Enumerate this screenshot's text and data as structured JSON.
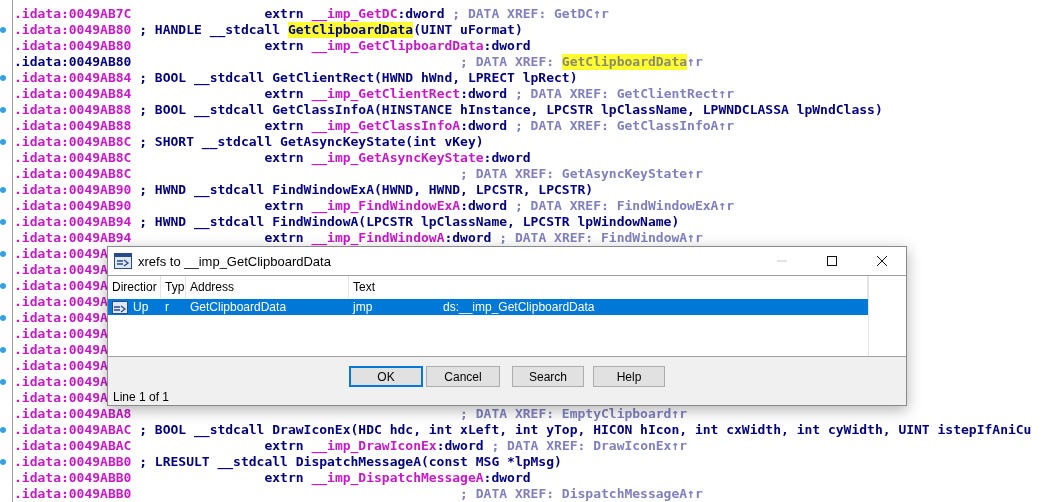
{
  "listing": {
    "rows": [
      {
        "address": ".idata:0049AB7C",
        "kind": "extrn",
        "current": false,
        "segments": [
          {
            "kind": "code",
            "text": "extrn "
          },
          {
            "kind": "name",
            "text": "__imp_GetDC"
          },
          {
            "kind": "code",
            "text": ":dword "
          },
          {
            "kind": "comment",
            "text": "; DATA XREF: GetDC↑r"
          }
        ]
      },
      {
        "address": ".idata:0049AB80",
        "kind": "decl",
        "current": false,
        "segments": [
          {
            "kind": "code",
            "text": "; HANDLE __stdcall "
          },
          {
            "kind": "code_match",
            "text": "GetClipboardData"
          },
          {
            "kind": "code",
            "text": "(UINT uFormat)"
          }
        ]
      },
      {
        "address": ".idata:0049AB80",
        "kind": "extrn",
        "current": false,
        "segments": [
          {
            "kind": "code",
            "text": "extrn "
          },
          {
            "kind": "name",
            "text": "__imp_GetClipboardData"
          },
          {
            "kind": "code",
            "text": ":dword"
          }
        ]
      },
      {
        "address": ".idata:0049AB80",
        "kind": "xref",
        "current": true,
        "segments": [
          {
            "kind": "comment",
            "text": "; DATA XREF: "
          },
          {
            "kind": "comment_match",
            "text": "GetClipboardData"
          },
          {
            "kind": "comment",
            "text": "↑r"
          }
        ]
      },
      {
        "address": ".idata:0049AB84",
        "kind": "decl",
        "current": false,
        "segments": [
          {
            "kind": "code",
            "text": "; BOOL __stdcall GetClientRect(HWND hWnd, LPRECT lpRect)"
          }
        ]
      },
      {
        "address": ".idata:0049AB84",
        "kind": "extrn",
        "current": false,
        "segments": [
          {
            "kind": "code",
            "text": "extrn "
          },
          {
            "kind": "name",
            "text": "__imp_GetClientRect"
          },
          {
            "kind": "code",
            "text": ":dword "
          },
          {
            "kind": "comment",
            "text": "; DATA XREF: GetClientRect↑r"
          }
        ]
      },
      {
        "address": ".idata:0049AB88",
        "kind": "decl",
        "current": false,
        "segments": [
          {
            "kind": "code",
            "text": "; BOOL __stdcall GetClassInfoA(HINSTANCE hInstance, LPCSTR lpClassName, LPWNDCLASSA lpWndClass)"
          }
        ]
      },
      {
        "address": ".idata:0049AB88",
        "kind": "extrn",
        "current": false,
        "segments": [
          {
            "kind": "code",
            "text": "extrn "
          },
          {
            "kind": "name",
            "text": "__imp_GetClassInfoA"
          },
          {
            "kind": "code",
            "text": ":dword "
          },
          {
            "kind": "comment",
            "text": "; DATA XREF: GetClassInfoA↑r"
          }
        ]
      },
      {
        "address": ".idata:0049AB8C",
        "kind": "decl",
        "current": false,
        "segments": [
          {
            "kind": "code",
            "text": "; SHORT __stdcall GetAsyncKeyState(int vKey)"
          }
        ]
      },
      {
        "address": ".idata:0049AB8C",
        "kind": "extrn",
        "current": false,
        "segments": [
          {
            "kind": "code",
            "text": "extrn "
          },
          {
            "kind": "name",
            "text": "__imp_GetAsyncKeyState"
          },
          {
            "kind": "code",
            "text": ":dword"
          }
        ]
      },
      {
        "address": ".idata:0049AB8C",
        "kind": "xref",
        "current": false,
        "segments": [
          {
            "kind": "comment",
            "text": "; DATA XREF: GetAsyncKeyState↑r"
          }
        ]
      },
      {
        "address": ".idata:0049AB90",
        "kind": "decl",
        "current": false,
        "segments": [
          {
            "kind": "code",
            "text": "; HWND __stdcall FindWindowExA(HWND, HWND, LPCSTR, LPCSTR)"
          }
        ]
      },
      {
        "address": ".idata:0049AB90",
        "kind": "extrn",
        "current": false,
        "segments": [
          {
            "kind": "code",
            "text": "extrn "
          },
          {
            "kind": "name",
            "text": "__imp_FindWindowExA"
          },
          {
            "kind": "code",
            "text": ":dword "
          },
          {
            "kind": "comment",
            "text": "; DATA XREF: FindWindowExA↑r"
          }
        ]
      },
      {
        "address": ".idata:0049AB94",
        "kind": "decl",
        "current": false,
        "segments": [
          {
            "kind": "code",
            "text": "; HWND __stdcall FindWindowA(LPCSTR lpClassName, LPCSTR lpWindowName)"
          }
        ]
      },
      {
        "address": ".idata:0049AB94",
        "kind": "extrn",
        "current": false,
        "segments": [
          {
            "kind": "code",
            "text": "extrn "
          },
          {
            "kind": "name",
            "text": "__imp_FindWindowA"
          },
          {
            "kind": "code",
            "text": ":dword "
          },
          {
            "kind": "comment",
            "text": "; DATA XREF: FindWindowA↑r"
          }
        ]
      },
      {
        "address": ".idata:0049A",
        "kind": "decl",
        "current": false,
        "segments": []
      },
      {
        "address": ".idata:0049A",
        "kind": "extrn",
        "current": false,
        "segments": []
      },
      {
        "address": ".idata:0049A",
        "kind": "decl",
        "current": false,
        "segments": []
      },
      {
        "address": ".idata:0049A",
        "kind": "extrn",
        "current": false,
        "segments": []
      },
      {
        "address": ".idata:0049A",
        "kind": "decl",
        "current": false,
        "segments": []
      },
      {
        "address": ".idata:0049A",
        "kind": "extrn",
        "current": false,
        "segments": []
      },
      {
        "address": ".idata:0049A",
        "kind": "decl",
        "current": false,
        "segments": []
      },
      {
        "address": ".idata:0049A",
        "kind": "extrn",
        "current": false,
        "segments": []
      },
      {
        "address": ".idata:0049A",
        "kind": "decl",
        "current": false,
        "segments": []
      },
      {
        "address": ".idata:0049A",
        "kind": "extrn",
        "current": false,
        "segments": []
      },
      {
        "address": ".idata:0049ABA8",
        "kind": "xref",
        "current": false,
        "segments": [
          {
            "kind": "comment",
            "text": "; DATA XREF: EmptyClipboard↑r"
          }
        ]
      },
      {
        "address": ".idata:0049ABAC",
        "kind": "decl",
        "current": false,
        "segments": [
          {
            "kind": "code",
            "text": "; BOOL __stdcall DrawIconEx(HDC hdc, int xLeft, int yTop, HICON hIcon, int cxWidth, int cyWidth, UINT istepIfAniCu"
          }
        ]
      },
      {
        "address": ".idata:0049ABAC",
        "kind": "extrn",
        "current": false,
        "segments": [
          {
            "kind": "code",
            "text": "extrn "
          },
          {
            "kind": "name",
            "text": "__imp_DrawIconEx"
          },
          {
            "kind": "code",
            "text": ":dword "
          },
          {
            "kind": "comment",
            "text": "; DATA XREF: DrawIconEx↑r"
          }
        ]
      },
      {
        "address": ".idata:0049ABB0",
        "kind": "decl",
        "current": false,
        "segments": [
          {
            "kind": "code",
            "text": "; LRESULT __stdcall DispatchMessageA(const MSG *lpMsg)"
          }
        ]
      },
      {
        "address": ".idata:0049ABB0",
        "kind": "extrn",
        "current": false,
        "segments": [
          {
            "kind": "code",
            "text": "extrn "
          },
          {
            "kind": "name",
            "text": "__imp_DispatchMessageA"
          },
          {
            "kind": "code",
            "text": ":dword"
          }
        ]
      },
      {
        "address": ".idata:0049ABB0",
        "kind": "xref",
        "current": false,
        "segments": [
          {
            "kind": "comment",
            "text": "; DATA XREF: DispatchMessageA↑r"
          }
        ]
      }
    ]
  },
  "dialog": {
    "title": "xrefs to __imp_GetClipboardData",
    "columns": [
      "Directior",
      "Typ",
      "Address",
      "Text"
    ],
    "rows": [
      {
        "selected": true,
        "cells": [
          "Up",
          "r",
          "GetClipboardData",
          "jmp",
          "ds:__imp_GetClipboardData"
        ]
      }
    ],
    "buttons": [
      {
        "label": "OK",
        "default": true
      },
      {
        "label": "Cancel",
        "default": false
      },
      {
        "label": "Search",
        "default": false
      },
      {
        "label": "Help",
        "default": false
      }
    ],
    "status": "Line 1 of 1"
  }
}
